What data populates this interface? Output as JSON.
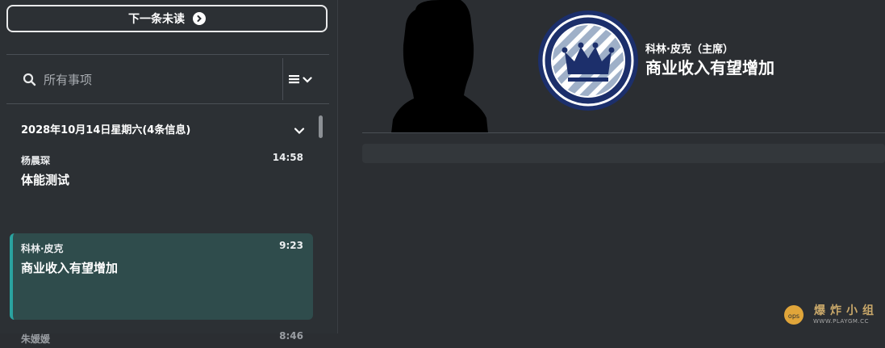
{
  "sidebar": {
    "next_unread_label": "下一条未读",
    "search": {
      "placeholder": "所有事项"
    },
    "date_group": {
      "label": "2028年10月14日星期六(4条信息)"
    },
    "messages": [
      {
        "sender": "杨晨琛",
        "time": "14:58",
        "subject": "体能测试"
      },
      {
        "sender": "科林·皮克",
        "time": "9:23",
        "subject": "商业收入有望增加",
        "selected": true
      },
      {
        "sender": "朱媛媛",
        "time": "8:46",
        "subject": ""
      }
    ]
  },
  "detail": {
    "sender_title": "科林·皮克（主席）",
    "subject": "商业收入有望增加"
  },
  "watermark": {
    "text": "爆炸小组",
    "url": "WWW.PLAYGM.CC",
    "badge": "ops"
  },
  "icons": {
    "next_arrow": "chevron-right-circle-icon",
    "search": "search-icon",
    "filter": "list-menu-icon",
    "dropdown": "chevron-down-icon",
    "club": "crown-club-badge-icon"
  },
  "colors": {
    "background": "#2b2e32",
    "sidebar": "#2c3034",
    "selected_row": "#2f4c4c",
    "selected_accent": "#2aa3a0",
    "badge_navy": "#1c2f6b"
  }
}
